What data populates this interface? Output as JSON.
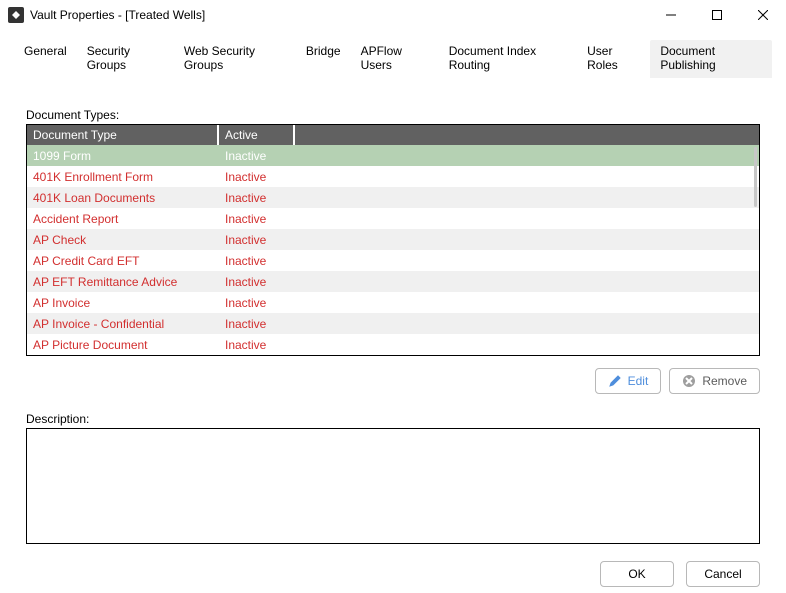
{
  "window": {
    "title": "Vault Properties - [Treated Wells]"
  },
  "tabs": {
    "items": [
      {
        "label": "General"
      },
      {
        "label": "Security Groups"
      },
      {
        "label": "Web Security Groups"
      },
      {
        "label": "Bridge"
      },
      {
        "label": "APFlow Users"
      },
      {
        "label": "Document Index Routing"
      },
      {
        "label": "User Roles"
      },
      {
        "label": "Document Publishing"
      }
    ],
    "active_index": 7
  },
  "doc_types": {
    "section_label": "Document Types:",
    "columns": {
      "document_type": "Document Type",
      "active": "Active"
    },
    "rows": [
      {
        "document_type": "1099 Form",
        "active": "Inactive"
      },
      {
        "document_type": "401K Enrollment Form",
        "active": "Inactive"
      },
      {
        "document_type": "401K Loan Documents",
        "active": "Inactive"
      },
      {
        "document_type": "Accident Report",
        "active": "Inactive"
      },
      {
        "document_type": "AP Check",
        "active": "Inactive"
      },
      {
        "document_type": "AP Credit Card EFT",
        "active": "Inactive"
      },
      {
        "document_type": "AP EFT Remittance Advice",
        "active": "Inactive"
      },
      {
        "document_type": "AP Invoice",
        "active": "Inactive"
      },
      {
        "document_type": "AP Invoice - Confidential",
        "active": "Inactive"
      },
      {
        "document_type": "AP Picture Document",
        "active": "Inactive"
      }
    ],
    "selected_index": 0
  },
  "buttons": {
    "edit": "Edit",
    "remove": "Remove"
  },
  "description": {
    "label": "Description:",
    "value": ""
  },
  "footer": {
    "ok": "OK",
    "cancel": "Cancel"
  }
}
